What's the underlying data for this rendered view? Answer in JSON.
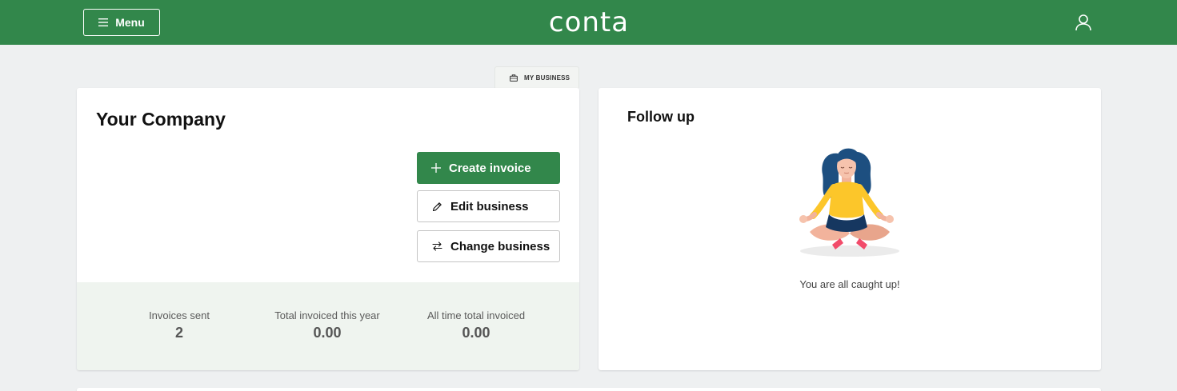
{
  "topbar": {
    "menu_label": "Menu",
    "logo_text": "conta",
    "brand_color": "#32874b",
    "menu_icon": "hamburger-icon",
    "user_icon": "user-icon"
  },
  "business_tab": {
    "label": "MY BUSINESS",
    "icon": "briefcase-icon"
  },
  "company_card": {
    "title": "Your Company",
    "actions": {
      "create_invoice": "Create invoice",
      "edit_business": "Edit business",
      "change_business": "Change business"
    },
    "stats": [
      {
        "label": "Invoices sent",
        "value": "2"
      },
      {
        "label": "Total invoiced this year",
        "value": "0.00"
      },
      {
        "label": "All time total invoiced",
        "value": "0.00"
      }
    ]
  },
  "follow_up": {
    "title": "Follow up",
    "message": "You are all caught up!",
    "illustration": "meditating-woman-illustration"
  }
}
